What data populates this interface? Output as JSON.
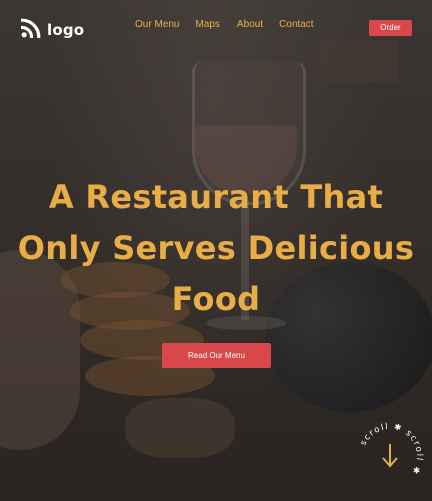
{
  "nav": {
    "logo_text": "logo",
    "menu": [
      {
        "label": "Our Menu"
      },
      {
        "label": "Maps"
      },
      {
        "label": "About"
      },
      {
        "label": "Contact"
      }
    ],
    "order_label": "Order"
  },
  "hero": {
    "headline_lines": [
      "A Restaurant That",
      "Only Serves Delicious",
      "Food"
    ],
    "cta_label": "Read Our Menu"
  },
  "scroll": {
    "label": "scroll",
    "icon": "arrow-down-icon"
  },
  "colors": {
    "accent": "#e8ad46",
    "button": "#d8484a",
    "background": "#3a332e"
  }
}
